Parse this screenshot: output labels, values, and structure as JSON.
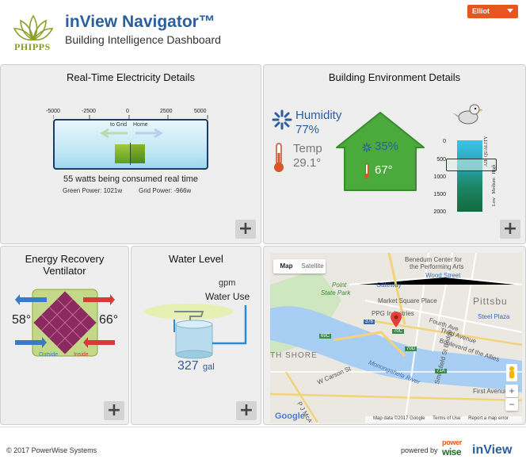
{
  "header": {
    "logo_text": "PHIPPS",
    "app_title": "inView Navigator™",
    "app_subtitle": "Building Intelligence Dashboard",
    "user_label": "Elliot"
  },
  "electricity": {
    "title": "Real-Time Electricity Details",
    "ticks": [
      "-5000",
      "-2500",
      "0",
      "2500",
      "5000"
    ],
    "to_grid": "to Grid",
    "home": "Home",
    "usage_text": "55 watts being consumed real time",
    "green_power": "Green Power: 1021w",
    "grid_power": "Grid Power: -966w",
    "meter_value_w": 55
  },
  "environment": {
    "title": "Building Environment Details",
    "humidity_label": "Humidity",
    "humidity_value": "77%",
    "temp_label": "Temp",
    "temp_value": "29.1°",
    "inside_humidity": "35%",
    "inside_temp": "67°",
    "aq_ticks": [
      "0",
      "500",
      "1000",
      "1500",
      "2000"
    ],
    "aq_axis_label": "AIR QUALITY",
    "aq_levels": "Low   Medium   High",
    "house_color": "#4aab3c"
  },
  "erv": {
    "title_line1": "Energy Recovery",
    "title_line2": "Ventilator",
    "outside_temp": "58°",
    "inside_temp": "66°",
    "outside_label": "Outside",
    "inside_label": "Inside"
  },
  "water": {
    "title": "Water Level",
    "gpm_label": "gpm",
    "use_label": "Water Use",
    "amount": "327",
    "unit": "gal"
  },
  "map": {
    "type_map": "Map",
    "type_satellite": "Satellite",
    "labels": {
      "benedum": "Benedum Center for",
      "benedum2": "the Performing Arts",
      "gateway": "Gateway",
      "wood_street": "Wood Street",
      "point_state": "Point",
      "point_state2": "State Park",
      "market_square": "Market Square Place",
      "ppg": "PPG Industries",
      "pittsburgh": "Pittsbu",
      "steel_plaza": "Steel Plaza",
      "fourth_ave": "Fourth Ave",
      "third_ave": "Third Avenue",
      "blvd_allies": "Boulevard of the Allies",
      "th_shore": "TH SHORE",
      "w_carson": "W Carson St",
      "mcardle": "P J McArdle Roadway",
      "monongahela": "Monongahela River",
      "first_ave": "First Avenue",
      "smithfield": "Smithfield St Bridge",
      "shield_279": "279",
      "shield_376": "376",
      "shield_19": "19",
      "shield_837": "837",
      "shield_70c": "70C",
      "shield_70d": "70D",
      "shield_71a": "71A",
      "shield_69c": "69C"
    },
    "google": "Google",
    "footer_data": "Map data ©2017 Google",
    "footer_terms": "Terms of Use",
    "footer_report": "Report a map error",
    "zoom_in": "+",
    "zoom_out": "−"
  },
  "footer": {
    "copyright": "© 2017 PowerWise Systems",
    "powered_by": "powered by",
    "pw_power": "power",
    "pw_wise": "wise",
    "inview": "inView"
  },
  "buttons": {
    "expand": "+"
  }
}
